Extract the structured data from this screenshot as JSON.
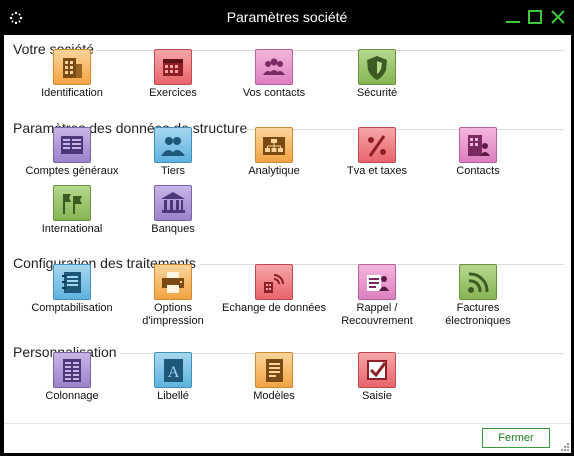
{
  "window": {
    "title": "Paramètres société",
    "colors": {
      "titlebar": "#000000",
      "accent": "#3cc83c",
      "content": "#ffffff"
    }
  },
  "sections": [
    {
      "title": "Votre société",
      "items": [
        {
          "label": "Identification",
          "icon": "building-icon",
          "color": "orange"
        },
        {
          "label": "Exercices",
          "icon": "calendar-icon",
          "color": "red"
        },
        {
          "label": "Vos contacts",
          "icon": "people-icon",
          "color": "pink"
        },
        {
          "label": "Sécurité",
          "icon": "shield-icon",
          "color": "green"
        }
      ]
    },
    {
      "title": "Paramètres des données de structure",
      "items": [
        {
          "label": "Comptes généraux",
          "icon": "ledger-icon",
          "color": "purple"
        },
        {
          "label": "Tiers",
          "icon": "users-icon",
          "color": "blue"
        },
        {
          "label": "Analytique",
          "icon": "org-chart-icon",
          "color": "orange"
        },
        {
          "label": "Tva et taxes",
          "icon": "percent-icon",
          "color": "red"
        },
        {
          "label": "Contacts",
          "icon": "building-person-icon",
          "color": "pink"
        },
        {
          "label": "International",
          "icon": "flags-icon",
          "color": "green"
        },
        {
          "label": "Banques",
          "icon": "bank-icon",
          "color": "purple"
        }
      ]
    },
    {
      "title": "Configuration des traitements",
      "items": [
        {
          "label": "Comptabilisation",
          "icon": "notebook-icon",
          "color": "blue"
        },
        {
          "label": "Options\nd'impression",
          "icon": "printer-icon",
          "color": "orange"
        },
        {
          "label": "Echange de données",
          "icon": "data-exchange-icon",
          "color": "red"
        },
        {
          "label": "Rappel /\nRecouvrement",
          "icon": "reminder-icon",
          "color": "pink"
        },
        {
          "label": "Factures\nélectroniques",
          "icon": "rss-icon",
          "color": "green"
        }
      ]
    },
    {
      "title": "Personnalisation",
      "items": [
        {
          "label": "Colonnage",
          "icon": "columns-icon",
          "color": "purple"
        },
        {
          "label": "Libellé",
          "icon": "letter-a-icon",
          "color": "blue"
        },
        {
          "label": "Modèles",
          "icon": "template-icon",
          "color": "orange"
        },
        {
          "label": "Saisie",
          "icon": "checkbox-icon",
          "color": "red"
        }
      ]
    }
  ],
  "footer": {
    "close_label": "Fermer"
  }
}
